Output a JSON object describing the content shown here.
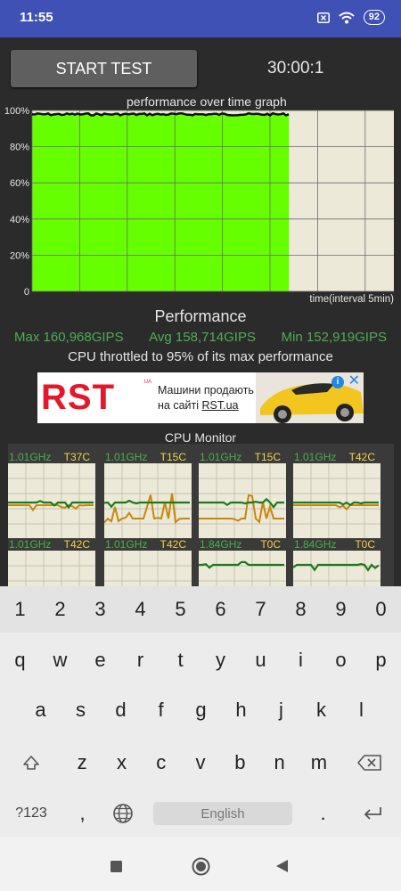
{
  "status_bar": {
    "time": "11:55",
    "battery": "92"
  },
  "app": {
    "start_button": "START TEST",
    "timer": "30:00:1",
    "graph": {
      "title": "performance over time graph",
      "y_ticks": [
        "100%",
        "80%",
        "60%",
        "40%",
        "20%",
        "0"
      ],
      "x_label": "time(interval 5min)",
      "fill_fraction_of_width": 0.71,
      "level_percent": 98
    },
    "performance": {
      "heading": "Performance",
      "max": "Max 160,968GIPS",
      "avg": "Avg 158,714GIPS",
      "min": "Min 152,919GIPS",
      "throttle": "CPU throttled to 95% of its max performance"
    },
    "ad": {
      "logo": "RST",
      "logo_sub": ".UA",
      "line1": "Машини продають",
      "line2_prefix": "на сайті ",
      "line2_link": "RST.ua"
    },
    "cpu_monitor": {
      "heading": "CPU Monitor",
      "cores": [
        {
          "freq": "1.01GHz",
          "temp": "T37C"
        },
        {
          "freq": "1.01GHz",
          "temp": "T15C"
        },
        {
          "freq": "1.01GHz",
          "temp": "T15C"
        },
        {
          "freq": "1.01GHz",
          "temp": "T42C"
        },
        {
          "freq": "1.01GHz",
          "temp": "T42C"
        },
        {
          "freq": "1.01GHz",
          "temp": "T42C"
        },
        {
          "freq": "1.84GHz",
          "temp": "T0C"
        },
        {
          "freq": "1.84GHz",
          "temp": "T0C"
        }
      ]
    }
  },
  "keyboard": {
    "numbers": [
      "1",
      "2",
      "3",
      "4",
      "5",
      "6",
      "7",
      "8",
      "9",
      "0"
    ],
    "row1": [
      "q",
      "w",
      "e",
      "r",
      "t",
      "y",
      "u",
      "i",
      "o",
      "p"
    ],
    "row2": [
      "a",
      "s",
      "d",
      "f",
      "g",
      "h",
      "j",
      "k",
      "l"
    ],
    "row3": [
      "z",
      "x",
      "c",
      "v",
      "b",
      "n",
      "m"
    ],
    "symbols_key": "?123",
    "comma": ",",
    "space_label": "English",
    "period": "."
  },
  "icons": {
    "status": [
      "notification-x-icon",
      "wifi-icon",
      "battery-icon"
    ],
    "keyboard": [
      "shift-icon",
      "backspace-icon",
      "globe-icon",
      "enter-icon"
    ],
    "nav": [
      "recents-icon",
      "home-icon",
      "back-icon"
    ]
  },
  "colors": {
    "status_bar": "#3f51b5",
    "graph_fill": "#66ff00",
    "stats_green": "#4caf50",
    "cpu_line_green": "#1b7a1b",
    "cpu_line_orange": "#c8860a",
    "temp_yellow": "#f0d44a"
  }
}
